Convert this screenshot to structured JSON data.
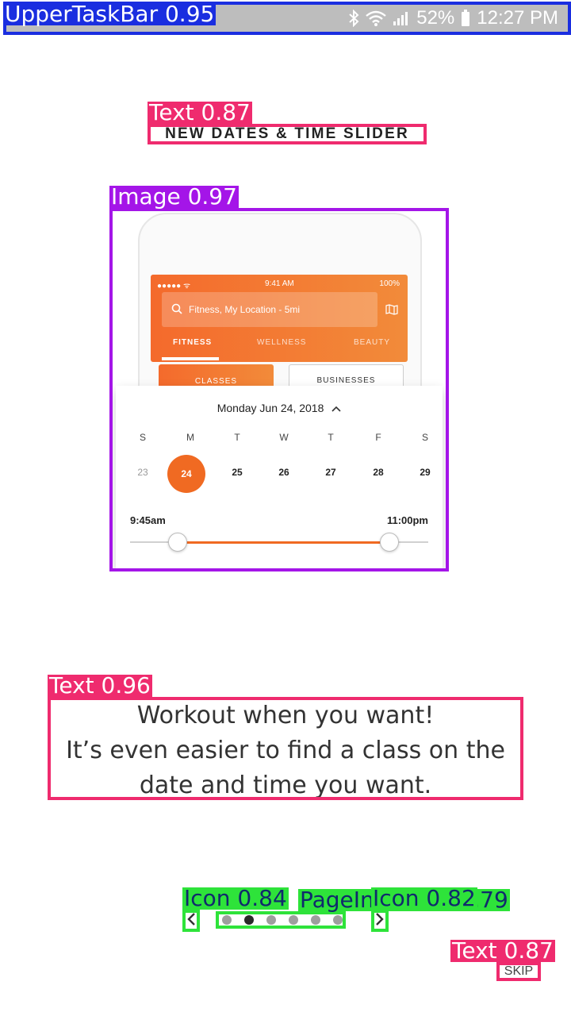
{
  "status_bar": {
    "battery": "52%",
    "time": "12:27 PM"
  },
  "onboarding": {
    "title": "NEW DATES & TIME SLIDER",
    "caption_lines": [
      "Workout when you want!",
      "It’s even easier to find a class on the",
      "date and time you want."
    ],
    "skip_label": "SKIP",
    "page_count": 6,
    "active_page": 1
  },
  "mockup": {
    "status_time": "9:41 AM",
    "status_battery": "100%",
    "search_text": "Fitness, My Location - 5mi",
    "tabs": [
      "FITNESS",
      "WELLNESS",
      "BEAUTY"
    ],
    "segments": [
      "CLASSES",
      "BUSINESSES"
    ],
    "date_label": "Monday Jun 24, 2018",
    "weekdays": [
      "S",
      "M",
      "T",
      "W",
      "T",
      "F",
      "S"
    ],
    "days": [
      "23",
      "24",
      "25",
      "26",
      "27",
      "28",
      "29"
    ],
    "selected_day": "24",
    "time_start": "9:45am",
    "time_end": "11:00pm",
    "slider_start": 0.16,
    "slider_end": 0.87,
    "accent_color": "#f06a22"
  },
  "detections": {
    "upper_taskbar": "UpperTaskBar  0.95",
    "title_text": "Text  0.87",
    "image": "Image  0.97",
    "caption_text": "Text  0.96",
    "prev_icon": "Icon  0.84",
    "page_indicator": "PageIndicator  0.79",
    "next_icon": "Icon  0.82",
    "skip_text": "Text  0.87"
  }
}
